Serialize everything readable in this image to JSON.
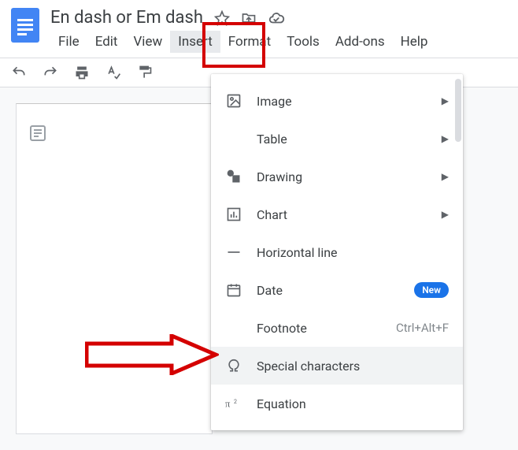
{
  "document": {
    "title": "En dash or Em dash"
  },
  "menubar": {
    "file": "File",
    "edit": "Edit",
    "view": "View",
    "insert": "Insert",
    "format": "Format",
    "tools": "Tools",
    "addons": "Add-ons",
    "help": "Help"
  },
  "insert_menu": {
    "image": "Image",
    "table": "Table",
    "drawing": "Drawing",
    "chart": "Chart",
    "horizontal_line": "Horizontal line",
    "date": "Date",
    "date_badge": "New",
    "footnote": "Footnote",
    "footnote_shortcut": "Ctrl+Alt+F",
    "special_characters": "Special characters",
    "equation": "Equation"
  }
}
